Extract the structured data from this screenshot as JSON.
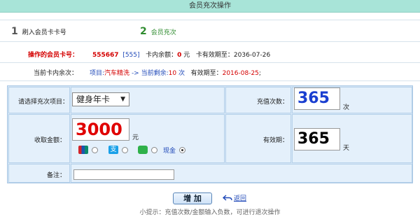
{
  "title": "会员充次操作",
  "steps": [
    {
      "num": "1",
      "label": "刷入会员卡卡号"
    },
    {
      "num": "2",
      "label": "会员充次"
    }
  ],
  "card_info": {
    "label": "操作的会员卡号：",
    "card_no": "555667",
    "card_id": "[555]",
    "balance_label": "卡内余额：",
    "balance_value": "0",
    "balance_unit": "元",
    "expire_label": "卡有效期至：",
    "expire_value": "2036-07-26"
  },
  "remaining": {
    "label": "当前卡内余次：",
    "item_prefix": "项目:",
    "item_name": "汽车精洗",
    "arrow_text": "->",
    "current_label": "当前剩余:",
    "current_value": "10",
    "current_unit": "次",
    "valid_label": "有效期至：",
    "valid_value": "2016-08-25",
    "valid_suffix": ";"
  },
  "form": {
    "project_label": "请选择充次项目：",
    "project_selected": "健身年卡",
    "count_label": "充值次数：",
    "count_value": "365",
    "count_unit": "次",
    "amount_label": "收取金额：",
    "amount_value": "3000",
    "amount_unit": "元",
    "valid_label": "有效期：",
    "valid_value": "365",
    "valid_unit": "天",
    "note_label": "备注：",
    "note_value": "",
    "payment": {
      "cash_label": "现金",
      "selected": "现金"
    }
  },
  "colors": {
    "unionpay": "#1a56b0",
    "alipay": "#1aa0e8",
    "wechat": "#2fb14a",
    "accent_red": "#e00000",
    "accent_blue": "#1a3fd0"
  },
  "actions": {
    "add_label": "增 加",
    "back_label": "返回"
  },
  "tip": "小提示：充值次数/金额输入负数，可进行退次操作"
}
